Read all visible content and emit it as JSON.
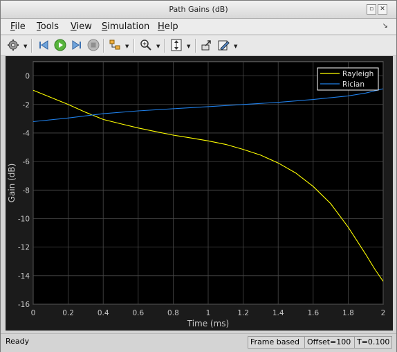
{
  "window": {
    "title": "Path Gains (dB)"
  },
  "menu": [
    {
      "mnemonic": "F",
      "rest": "ile"
    },
    {
      "mnemonic": "T",
      "rest": "ools"
    },
    {
      "mnemonic": "V",
      "rest": "iew"
    },
    {
      "mnemonic": "S",
      "rest": "imulation"
    },
    {
      "mnemonic": "H",
      "rest": "elp"
    }
  ],
  "toolbar": {
    "icons": [
      "gear-icon",
      "step-back-icon",
      "run-icon",
      "step-forward-icon",
      "stop-icon",
      "signal-select-icon",
      "zoom-in-icon",
      "scale-axes-icon",
      "undock-icon",
      "edit-style-icon"
    ]
  },
  "status": {
    "ready": "Ready",
    "frame": "Frame based",
    "offset": "Offset=100",
    "time": "T=0.100"
  },
  "colors": {
    "rayleigh": "#ffff00",
    "rician": "#1f7fe8",
    "plot_background": "#000000",
    "grid": "#4a4a4a"
  },
  "chart_data": {
    "type": "line",
    "title": "",
    "xlabel": "Time (ms)",
    "ylabel": "Gain (dB)",
    "xlim": [
      0,
      2
    ],
    "ylim": [
      -16,
      1
    ],
    "xticks": [
      "0",
      "0.2",
      "0.4",
      "0.6",
      "0.8",
      "1",
      "1.2",
      "1.4",
      "1.6",
      "1.8",
      "2"
    ],
    "yticks": [
      "0",
      "-2",
      "-4",
      "-6",
      "-8",
      "-10",
      "-12",
      "-14",
      "-16"
    ],
    "grid": true,
    "legend": "top-right",
    "series": [
      {
        "name": "Rayleigh",
        "x": [
          0,
          0.1,
          0.2,
          0.3,
          0.4,
          0.5,
          0.6,
          0.7,
          0.8,
          0.9,
          1.0,
          1.1,
          1.2,
          1.3,
          1.4,
          1.5,
          1.6,
          1.7,
          1.8,
          1.9,
          1.95,
          2.0
        ],
        "values": [
          -1.0,
          -1.5,
          -2.0,
          -2.55,
          -3.05,
          -3.35,
          -3.65,
          -3.9,
          -4.15,
          -4.35,
          -4.55,
          -4.8,
          -5.15,
          -5.55,
          -6.1,
          -6.8,
          -7.75,
          -8.95,
          -10.6,
          -12.5,
          -13.5,
          -14.4
        ]
      },
      {
        "name": "Rician",
        "x": [
          0,
          0.2,
          0.4,
          0.6,
          0.8,
          1.0,
          1.2,
          1.4,
          1.6,
          1.8,
          1.9,
          2.0
        ],
        "values": [
          -3.2,
          -2.95,
          -2.65,
          -2.45,
          -2.3,
          -2.15,
          -2.0,
          -1.85,
          -1.65,
          -1.4,
          -1.2,
          -0.9
        ]
      }
    ]
  }
}
